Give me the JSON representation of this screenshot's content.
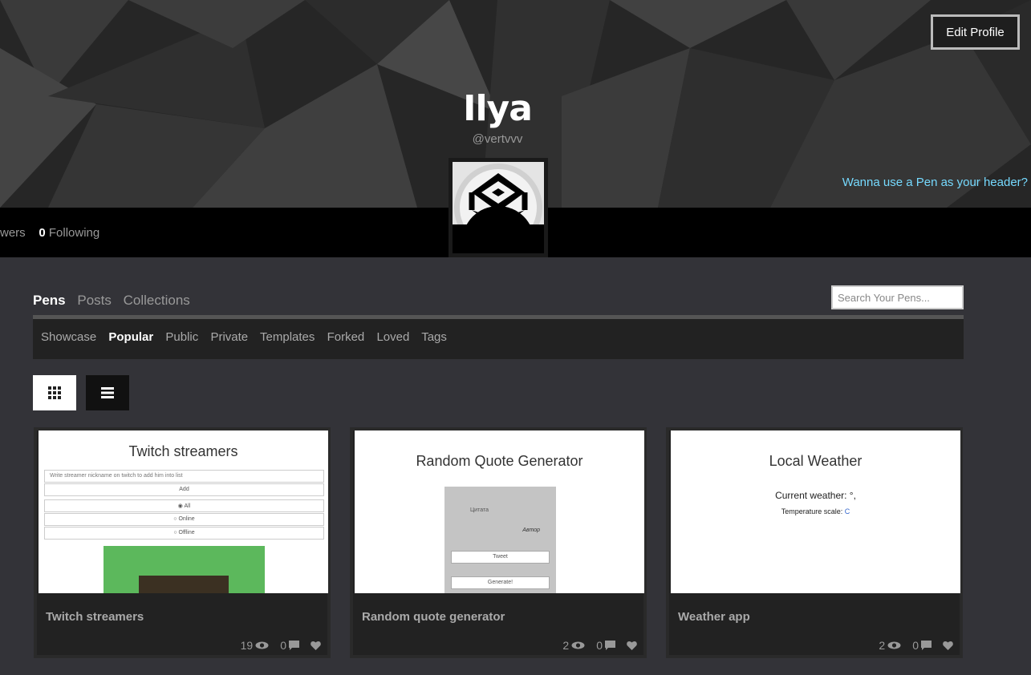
{
  "header": {
    "edit_profile_label": "Edit Profile",
    "name": "Ilya",
    "handle": "@vertvvv",
    "pen_header_link": "Wanna use a Pen as your header?",
    "followers_label": "wers",
    "following_count": "0",
    "following_label": "Following"
  },
  "tabs": [
    {
      "label": "Pens",
      "active": true
    },
    {
      "label": "Posts",
      "active": false
    },
    {
      "label": "Collections",
      "active": false
    }
  ],
  "search": {
    "placeholder": "Search Your Pens..."
  },
  "subnav": [
    {
      "label": "Showcase",
      "active": false
    },
    {
      "label": "Popular",
      "active": true
    },
    {
      "label": "Public",
      "active": false
    },
    {
      "label": "Private",
      "active": false
    },
    {
      "label": "Templates",
      "active": false
    },
    {
      "label": "Forked",
      "active": false
    },
    {
      "label": "Loved",
      "active": false
    },
    {
      "label": "Tags",
      "active": false
    }
  ],
  "view_icons": {
    "grid": "grid-icon",
    "list": "list-icon"
  },
  "cards": [
    {
      "title": "Twitch streamers",
      "views": "19",
      "comments": "0",
      "preview": {
        "heading": "Twitch streamers",
        "input_placeholder": "Write streamer nickname on twitch to add him into list",
        "add_label": "Add",
        "options": [
          "All",
          "Online",
          "Offline"
        ]
      }
    },
    {
      "title": "Random quote generator",
      "views": "2",
      "comments": "0",
      "preview": {
        "heading": "Random Quote Generator",
        "quote_text": "Цитата",
        "author": "Автор",
        "tweet_label": "Tweet",
        "generate_label": "Generate!"
      }
    },
    {
      "title": "Weather app",
      "views": "2",
      "comments": "0",
      "preview": {
        "heading": "Local Weather",
        "current": "Current weather: °,",
        "scale_label": "Temperature scale:",
        "scale_value": "C"
      }
    }
  ],
  "colors": {
    "accent_link": "#76daff",
    "background": "#333338",
    "card": "#222222"
  }
}
